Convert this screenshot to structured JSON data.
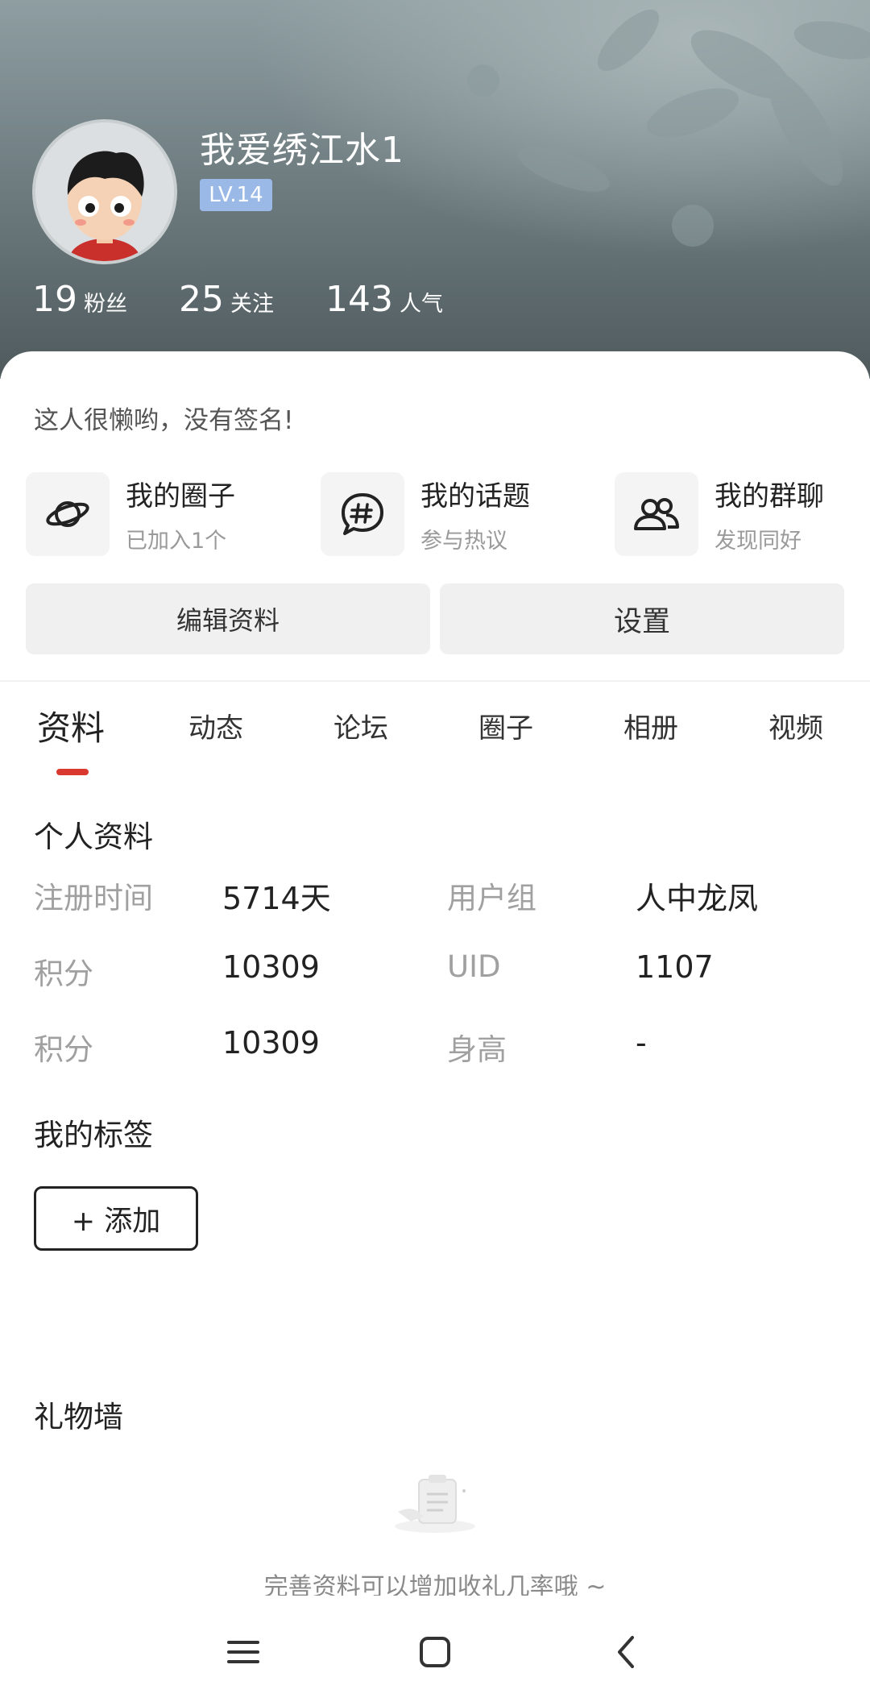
{
  "profile": {
    "username": "我爱绣江水1",
    "level": "LV.14",
    "stats": [
      {
        "num": "19",
        "label": "粉丝"
      },
      {
        "num": "25",
        "label": "关注"
      },
      {
        "num": "143",
        "label": "人气"
      }
    ]
  },
  "signature": "这人很懒哟，没有签名!",
  "shortcuts": [
    {
      "title": "我的圈子",
      "sub": "已加入1个",
      "icon": "planet-icon"
    },
    {
      "title": "我的话题",
      "sub": "参与热议",
      "icon": "hashtag-chat-icon"
    },
    {
      "title": "我的群聊",
      "sub": "发现同好",
      "icon": "group-people-icon"
    }
  ],
  "actions": {
    "edit": "编辑资料",
    "settings": "设置"
  },
  "tabs": [
    "资料",
    "动态",
    "论坛",
    "圈子",
    "相册",
    "视频"
  ],
  "active_tab": "资料",
  "personal": {
    "title": "个人资料",
    "rows": [
      {
        "l1": "注册时间",
        "v1": "5714天",
        "l2": "用户组",
        "v2": "人中龙凤"
      },
      {
        "l1": "积分",
        "v1": "10309",
        "l2": "UID",
        "v2": "1107"
      },
      {
        "l1": "积分",
        "v1": "10309",
        "l2": "身高",
        "v2": "-"
      }
    ]
  },
  "tags": {
    "title": "我的标签",
    "add_button": "+ 添加"
  },
  "gifts": {
    "title": "礼物墙",
    "hint": "完善资料可以增加收礼几率哦 ~"
  },
  "colors": {
    "accent": "#d9382e",
    "level_badge": "#9ab9e6"
  }
}
